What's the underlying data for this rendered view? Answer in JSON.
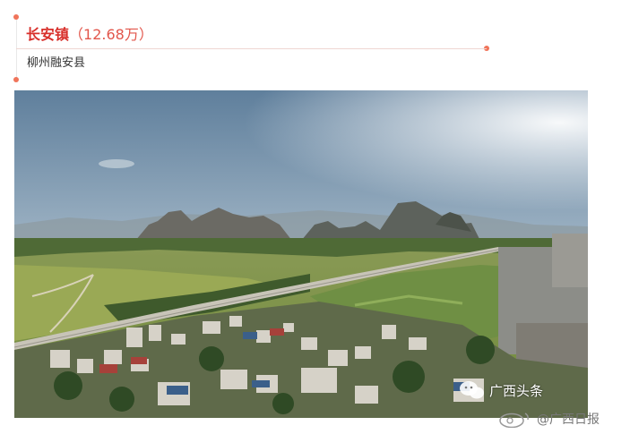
{
  "header": {
    "name": "长安镇",
    "population": "（12.68万）",
    "location": "柳州融安县"
  },
  "watermark": {
    "wechat_text": "广西头条",
    "weibo_text": "@广西日报"
  },
  "colors": {
    "accent": "#d8302b",
    "dot": "#f0745a"
  }
}
